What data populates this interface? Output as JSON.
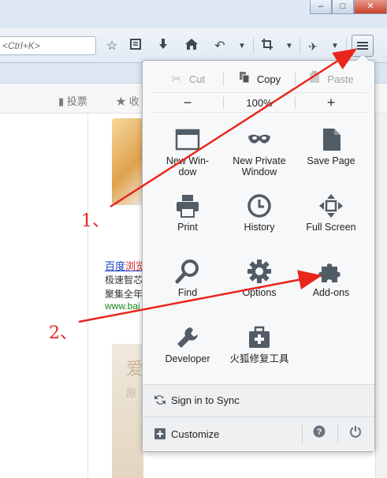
{
  "toolbar": {
    "search_placeholder": "<Ctrl+K>",
    "icons": [
      "star-icon",
      "reading-list-icon",
      "download-icon",
      "home-icon",
      "back-icon",
      "dropdown-icon",
      "crop-icon",
      "dropdown-icon",
      "extension-icon",
      "dropdown-icon",
      "menu-icon"
    ]
  },
  "sharebar": {
    "vote": "投票",
    "fav": "收"
  },
  "page": {
    "link_title_a": "百度",
    "link_title_b": "浏览",
    "line1": "极速智芯",
    "line2": "聚集全年",
    "url": "www.bai",
    "ad_char1": "爱",
    "ad_char2": "原"
  },
  "menu": {
    "edit": {
      "cut": "Cut",
      "copy": "Copy",
      "paste": "Paste"
    },
    "zoom": {
      "minus": "−",
      "value": "100%",
      "plus": "+"
    },
    "items": [
      {
        "label": "New Win-\ndow",
        "icon": "new-window-icon"
      },
      {
        "label": "New Private\nWindow",
        "icon": "private-mask-icon"
      },
      {
        "label": "Save Page",
        "icon": "save-page-icon"
      },
      {
        "label": "Print",
        "icon": "printer-icon"
      },
      {
        "label": "History",
        "icon": "clock-icon"
      },
      {
        "label": "Full Screen",
        "icon": "fullscreen-icon"
      },
      {
        "label": "Find",
        "icon": "magnifier-icon"
      },
      {
        "label": "Options",
        "icon": "gear-icon"
      },
      {
        "label": "Add-ons",
        "icon": "puzzle-icon"
      },
      {
        "label": "Developer",
        "icon": "wrench-icon"
      },
      {
        "label": "火狐修复工具",
        "icon": "toolbox-icon"
      }
    ],
    "sync": "Sign in to Sync",
    "customize": "Customize",
    "help_glyph": "?"
  },
  "annotations": {
    "first": "1、",
    "second": "2、"
  },
  "colors": {
    "annotation_red": "#e8261c",
    "link_blue": "#1a3dc1",
    "url_green": "#118a1c"
  }
}
